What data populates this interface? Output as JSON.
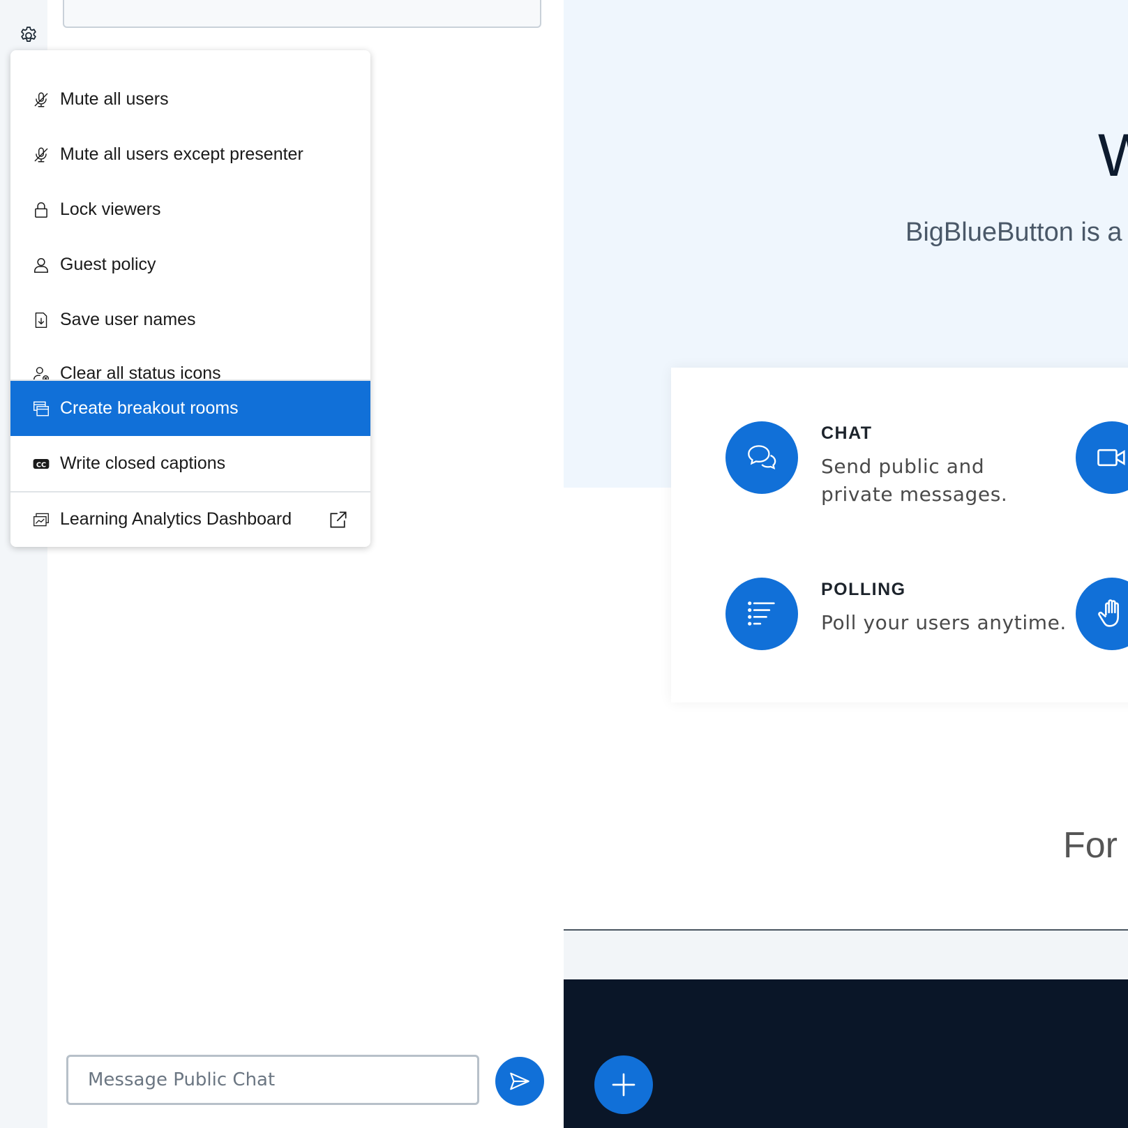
{
  "options_menu": {
    "items": [
      {
        "label": "Mute all users",
        "icon": "mic-off-icon"
      },
      {
        "label": "Mute all users except presenter",
        "icon": "mic-off-icon"
      },
      {
        "label": "Lock viewers",
        "icon": "lock-icon"
      },
      {
        "label": "Guest policy",
        "icon": "user-icon"
      },
      {
        "label": "Save user names",
        "icon": "file-download-icon"
      },
      {
        "label": "Clear all status icons",
        "icon": "user-clear-icon"
      },
      {
        "label": "Create breakout rooms",
        "icon": "breakout-rooms-icon",
        "active": true
      },
      {
        "label": "Write closed captions",
        "icon": "cc-icon"
      },
      {
        "label": "Learning Analytics Dashboard",
        "icon": "analytics-icon",
        "external": true
      }
    ]
  },
  "chat": {
    "input_placeholder": "Message Public Chat"
  },
  "presentation": {
    "welcome_heading": "W",
    "intro_text": "BigBlueButton is a",
    "features": [
      {
        "title": "CHAT",
        "description": "Send public and private messages.",
        "icon": "chat-icon"
      },
      {
        "title": "POLLING",
        "description": "Poll your users anytime.",
        "icon": "poll-list-icon"
      }
    ],
    "footer_text": "For"
  },
  "colors": {
    "accent": "#1170d8",
    "dark_bar": "#0a1628",
    "slide_bg": "#eff6fd"
  }
}
